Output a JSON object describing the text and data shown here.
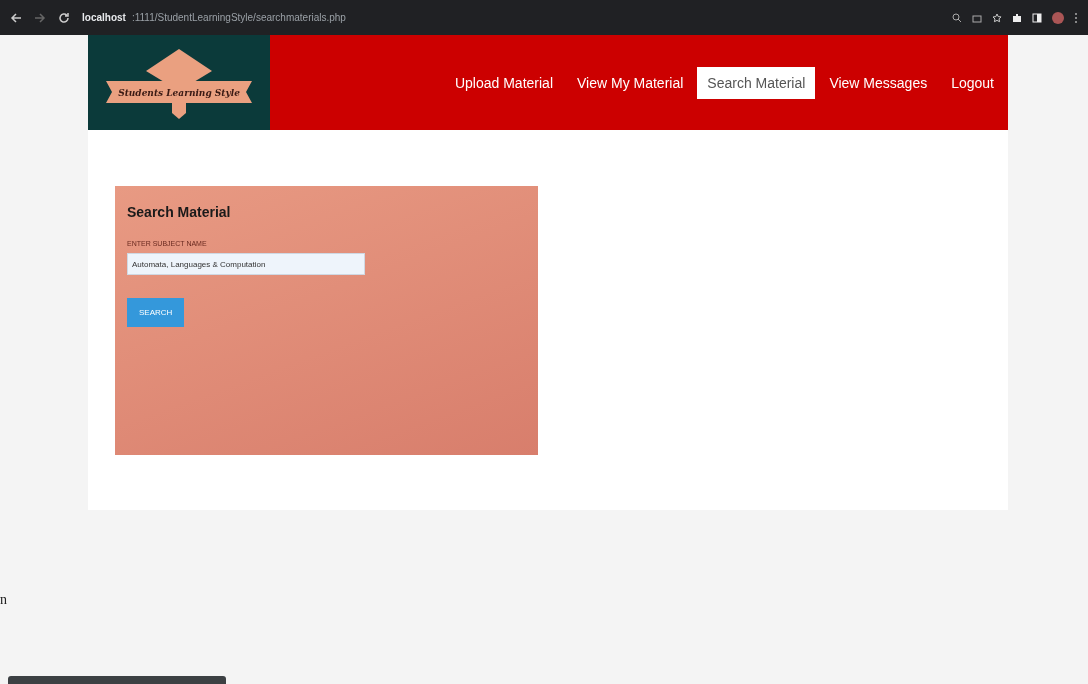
{
  "browser": {
    "address_host": "localhost",
    "address_path": ":1111/StudentLearningStyle/searchmaterials.php"
  },
  "logo": {
    "text": "Students Learning Style"
  },
  "nav": [
    {
      "label": "Upload Material",
      "selected": false
    },
    {
      "label": "View My Material",
      "selected": false
    },
    {
      "label": "Search Material",
      "selected": true
    },
    {
      "label": "View Messages",
      "selected": false
    },
    {
      "label": "Logout",
      "selected": false
    }
  ],
  "form": {
    "title": "Search Material",
    "field_label": "ENTER SUBJECT NAME",
    "value": "Automata, Languages & Computation",
    "button": "SEARCH"
  },
  "stray_text": "n"
}
